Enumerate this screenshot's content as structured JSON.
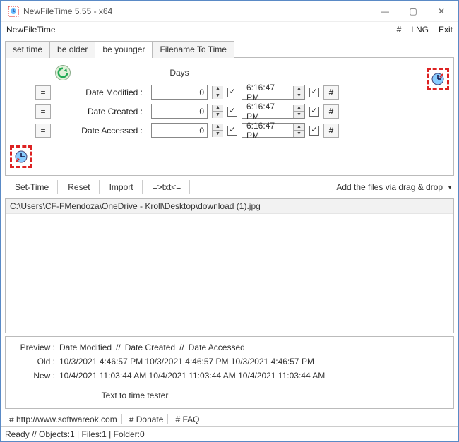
{
  "window": {
    "title": "NewFileTime 5.55 - x64"
  },
  "menubar": {
    "appname": "NewFileTime",
    "hash": "#",
    "lng": "LNG",
    "exit": "Exit"
  },
  "tabs": {
    "set_time": "set time",
    "be_older": "be older",
    "be_younger": "be younger",
    "filename_to_time": "Filename To Time"
  },
  "labels": {
    "days": "Days",
    "date_modified": "Date Modified :",
    "date_created": "Date Created :",
    "date_accessed": "Date Accessed :",
    "eq": "=",
    "hash": "#"
  },
  "values": {
    "days_modified": "0",
    "days_created": "0",
    "days_accessed": "0",
    "time_modified": "6:16:47 PM",
    "time_created": "6:16:47 PM",
    "time_accessed": "6:16:47 PM"
  },
  "toolbar": {
    "set_time": "Set-Time",
    "reset": "Reset",
    "import": "Import",
    "txt": "=>txt<=",
    "add_dragdrop": "Add the files via drag & drop"
  },
  "files": [
    "C:\\Users\\CF-FMendoza\\OneDrive - Kroll\\Desktop\\download (1).jpg"
  ],
  "preview": {
    "hdr_prefix": "Preview  :",
    "hdr_m": "Date Modified",
    "sep": "//",
    "hdr_c": "Date Created",
    "hdr_a": "Date Accessed",
    "old_label": "Old  :",
    "new_label": "New  :",
    "old_text": "10/3/2021 4:46:57 PM   10/3/2021 4:46:57 PM   10/3/2021 4:46:57 PM",
    "new_text": "10/4/2021 11:03:44 AM 10/4/2021 11:03:44 AM 10/4/2021 11:03:44 AM"
  },
  "ttt": {
    "label": "Text to time tester",
    "value": ""
  },
  "status": {
    "url": "# http://www.softwareok.com",
    "donate": "# Donate",
    "faq": "# FAQ",
    "ready": "Ready // Objects:1 | Files:1 | Folder:0"
  }
}
